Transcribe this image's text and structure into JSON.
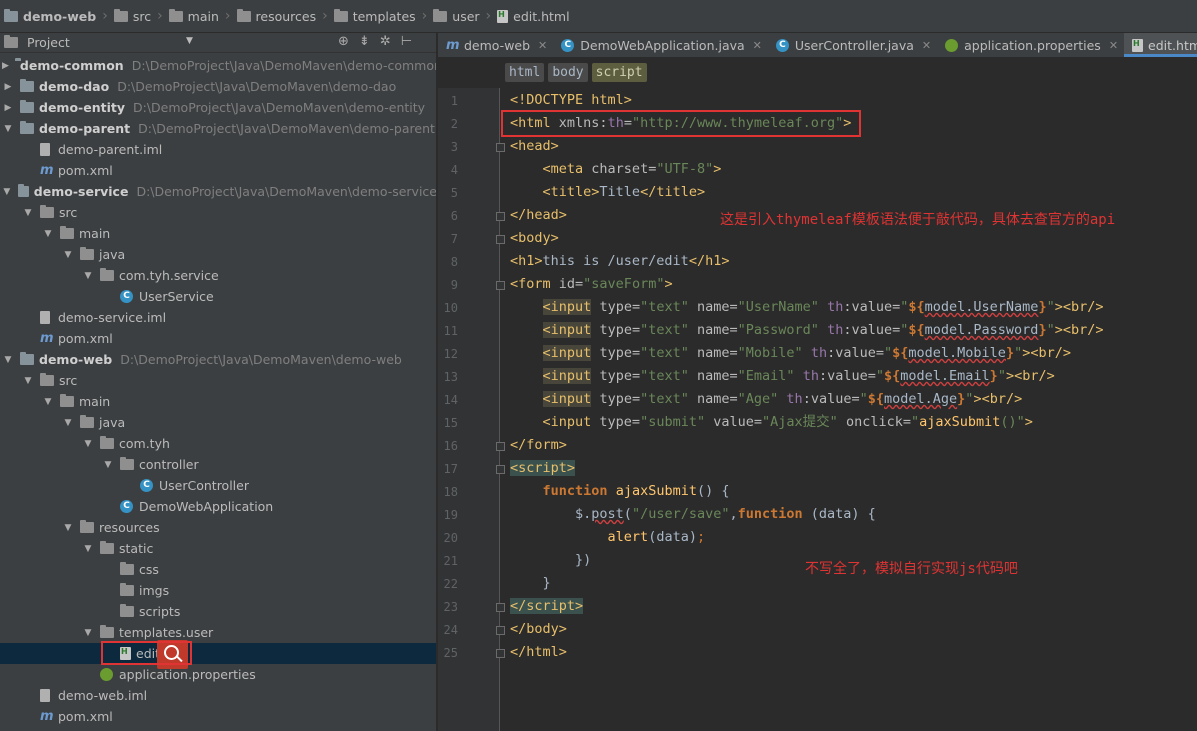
{
  "breadcrumb": [
    "demo-web",
    "src",
    "main",
    "resources",
    "templates",
    "user",
    "edit.html"
  ],
  "project_panel": {
    "title": "Project",
    "tree": [
      {
        "label": "demo-common",
        "path": "D:\\DemoProject\\Java\\DemoMaven\\demo-common",
        "type": "module",
        "expanded": false
      },
      {
        "label": "demo-dao",
        "path": "D:\\DemoProject\\Java\\DemoMaven\\demo-dao",
        "type": "module",
        "expanded": false
      },
      {
        "label": "demo-entity",
        "path": "D:\\DemoProject\\Java\\DemoMaven\\demo-entity",
        "type": "module",
        "expanded": false
      },
      {
        "label": "demo-parent",
        "path": "D:\\DemoProject\\Java\\DemoMaven\\demo-parent",
        "type": "module",
        "expanded": true
      },
      {
        "label": "demo-parent.iml",
        "type": "iml"
      },
      {
        "label": "pom.xml",
        "type": "pom"
      },
      {
        "label": "demo-service",
        "path": "D:\\DemoProject\\Java\\DemoMaven\\demo-service",
        "type": "module",
        "expanded": true
      },
      {
        "label": "src",
        "type": "folder",
        "expanded": true
      },
      {
        "label": "main",
        "type": "folder",
        "expanded": true
      },
      {
        "label": "java",
        "type": "folder",
        "expanded": true
      },
      {
        "label": "com.tyh.service",
        "type": "package",
        "expanded": true
      },
      {
        "label": "UserService",
        "type": "class"
      },
      {
        "label": "demo-service.iml",
        "type": "iml"
      },
      {
        "label": "pom.xml",
        "type": "pom"
      },
      {
        "label": "demo-web",
        "path": "D:\\DemoProject\\Java\\DemoMaven\\demo-web",
        "type": "module",
        "expanded": true
      },
      {
        "label": "src",
        "type": "folder",
        "expanded": true
      },
      {
        "label": "main",
        "type": "folder",
        "expanded": true
      },
      {
        "label": "java",
        "type": "folder",
        "expanded": true
      },
      {
        "label": "com.tyh",
        "type": "package",
        "expanded": true
      },
      {
        "label": "controller",
        "type": "package",
        "expanded": true
      },
      {
        "label": "UserController",
        "type": "class"
      },
      {
        "label": "DemoWebApplication",
        "type": "spring-class"
      },
      {
        "label": "resources",
        "type": "folder",
        "expanded": true
      },
      {
        "label": "static",
        "type": "folder",
        "expanded": true
      },
      {
        "label": "css",
        "type": "folder"
      },
      {
        "label": "imgs",
        "type": "folder"
      },
      {
        "label": "scripts",
        "type": "folder"
      },
      {
        "label": "templates.user",
        "type": "folder",
        "expanded": true
      },
      {
        "label": "edit.html",
        "type": "html",
        "selected": true
      },
      {
        "label": "application.properties",
        "type": "properties"
      },
      {
        "label": "demo-web.iml",
        "type": "iml"
      },
      {
        "label": "pom.xml",
        "type": "pom"
      }
    ]
  },
  "editor_tabs": [
    {
      "label": "demo-web",
      "icon": "maven-icon"
    },
    {
      "label": "DemoWebApplication.java",
      "icon": "spring-class-icon"
    },
    {
      "label": "UserController.java",
      "icon": "class-icon"
    },
    {
      "label": "application.properties",
      "icon": "spring-properties-icon"
    },
    {
      "label": "edit.html",
      "icon": "html-icon",
      "active": true
    }
  ],
  "tag_breadcrumb": [
    "html",
    "body",
    "script"
  ],
  "annotations": {
    "thymeleaf_note": "这是引入thymeleaf模板语法便于敲代码，具体去查官方的api",
    "js_note": "不写全了，模拟自行实现js代码吧"
  },
  "colors": {
    "highlight_box": "#e03333",
    "active_tab_underline": "#4a88c7"
  }
}
